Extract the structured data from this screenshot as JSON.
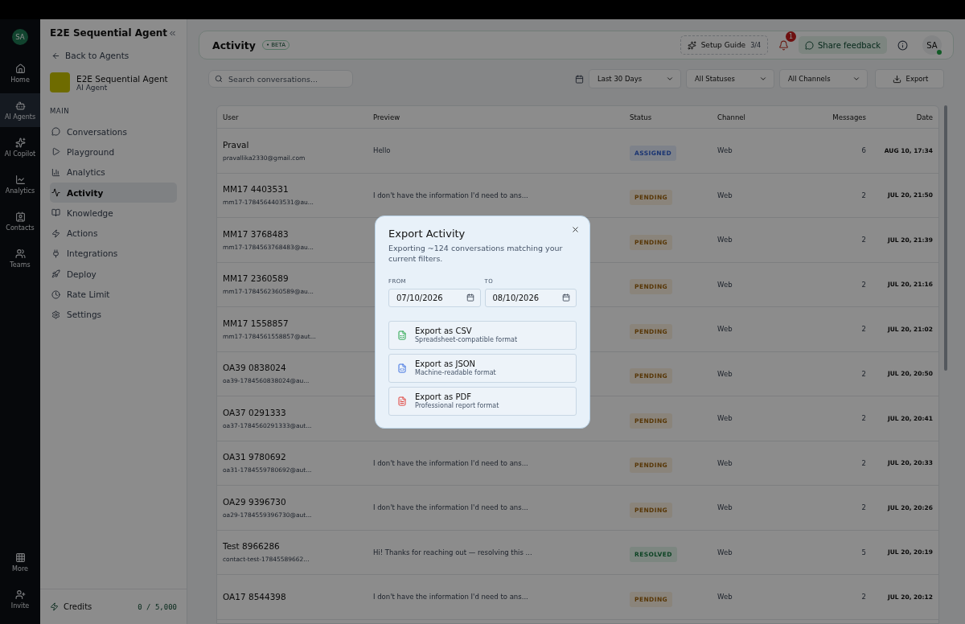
{
  "rail": {
    "avatar": "SA",
    "items": [
      {
        "label": "Home",
        "selected": false
      },
      {
        "label": "AI Agents",
        "selected": true
      },
      {
        "label": "AI Copilot",
        "selected": false
      },
      {
        "label": "Analytics",
        "selected": false
      },
      {
        "label": "Contacts",
        "selected": false
      },
      {
        "label": "Teams",
        "selected": false
      }
    ],
    "bottom": [
      {
        "label": "More"
      },
      {
        "label": "Invite"
      }
    ]
  },
  "sidebar": {
    "title": "E2E Sequential Agent",
    "back": "Back to Agents",
    "agent": {
      "name": "E2E Sequential Agent",
      "role": "AI Agent"
    },
    "section": "MAIN",
    "items": [
      {
        "label": "Conversations",
        "selected": false
      },
      {
        "label": "Playground",
        "selected": false
      },
      {
        "label": "Analytics",
        "selected": false
      },
      {
        "label": "Activity",
        "selected": true
      },
      {
        "label": "Knowledge",
        "selected": false
      },
      {
        "label": "Actions",
        "selected": false
      },
      {
        "label": "Integrations",
        "selected": false
      },
      {
        "label": "Deploy",
        "selected": false
      },
      {
        "label": "Rate Limit",
        "selected": false
      },
      {
        "label": "Settings",
        "selected": false
      }
    ],
    "credits": {
      "label": "Credits",
      "value": "0 / 5,000"
    }
  },
  "header": {
    "title": "Activity",
    "badge": "• BETA",
    "setup": {
      "label": "Setup Guide",
      "steps": "3/4"
    },
    "notifications": "1",
    "feedback": "Share feedback",
    "avatar": "SA"
  },
  "toolbar": {
    "search": {
      "placeholder": "Search conversations..."
    },
    "filters": [
      "Last 30 Days",
      "All Statuses",
      "All Channels"
    ],
    "export": "Export"
  },
  "table": {
    "columns": [
      "User",
      "Preview",
      "Status",
      "Channel",
      "Messages",
      "Date"
    ],
    "rows": [
      {
        "user": "Praval",
        "email": "pravallika2330@gmail.com",
        "preview": "Hello",
        "status": "ASSIGNED",
        "kind": "assigned",
        "channel": "Web",
        "messages": "6",
        "date": "AUG 10, 17:34"
      },
      {
        "user": "MM17 4403531",
        "email": "mm17-1784564403531@au...",
        "preview": "I don't have the information I'd need to ans...",
        "status": "PENDING",
        "kind": "pending",
        "channel": "Web",
        "messages": "2",
        "date": "JUL 20, 21:50"
      },
      {
        "user": "MM17 3768483",
        "email": "mm17-1784563768483@au...",
        "status": "PENDING",
        "kind": "pending",
        "channel": "Web",
        "messages": "2",
        "date": "JUL 20, 21:39"
      },
      {
        "user": "MM17 2360589",
        "email": "mm17-1784562360589@au...",
        "status": "PENDING",
        "kind": "pending",
        "channel": "Web",
        "messages": "2",
        "date": "JUL 20, 21:16"
      },
      {
        "user": "MM17 1558857",
        "email": "mm17-1784561558857@aut...",
        "status": "PENDING",
        "kind": "pending",
        "channel": "Web",
        "messages": "2",
        "date": "JUL 20, 21:02"
      },
      {
        "user": "OA39 0838024",
        "email": "oa39-1784560838024@au...",
        "status": "PENDING",
        "kind": "pending",
        "channel": "Web",
        "messages": "2",
        "date": "JUL 20, 20:50"
      },
      {
        "user": "OA37 0291333",
        "email": "oa37-1784560291333@aut...",
        "status": "PENDING",
        "kind": "pending",
        "channel": "Web",
        "messages": "2",
        "date": "JUL 20, 20:41"
      },
      {
        "user": "OA31 9780692",
        "email": "oa31-1784559780692@aut...",
        "preview": "I don't have the information I'd need to ans...",
        "status": "PENDING",
        "kind": "pending",
        "channel": "Web",
        "messages": "2",
        "date": "JUL 20, 20:33"
      },
      {
        "user": "OA29 9396730",
        "email": "oa29-1784559396730@aut...",
        "preview": "I don't have the information I'd need to ans...",
        "status": "PENDING",
        "kind": "pending",
        "channel": "Web",
        "messages": "2",
        "date": "JUL 20, 20:26"
      },
      {
        "user": "Test 8966286",
        "email": "contact-test-17845589662...",
        "preview": "Hi! Thanks for reaching out — resolving this ...",
        "status": "RESOLVED",
        "kind": "resolved",
        "channel": "Web",
        "messages": "5",
        "date": "JUL 20, 20:19"
      },
      {
        "user": "OA17 8544398",
        "preview": "I don't have the information I'd need to ans...",
        "status": "PENDING",
        "kind": "pending",
        "channel": "Web",
        "messages": "2",
        "date": "JUL 20, 20:12"
      }
    ]
  },
  "modal": {
    "title": "Export Activity",
    "subtitle": "Exporting ~124 conversations matching your current filters.",
    "from": {
      "label": "FROM",
      "value": "07/10/2026"
    },
    "to": {
      "label": "TO",
      "value": "08/10/2026"
    },
    "options": [
      {
        "kind": "csv",
        "title": "Export as CSV",
        "description": "Spreadsheet-compatible format"
      },
      {
        "kind": "json",
        "title": "Export as JSON",
        "description": "Machine-readable format"
      },
      {
        "kind": "pdf",
        "title": "Export as PDF",
        "description": "Professional report format"
      }
    ]
  }
}
